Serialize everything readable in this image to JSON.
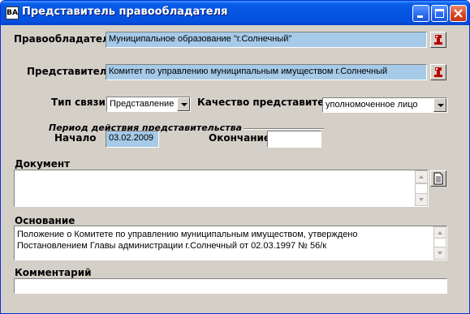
{
  "window": {
    "title": "Представитель правообладателя",
    "icon_text": "BA"
  },
  "form": {
    "owner": {
      "label": "Правообладатель",
      "value": "Муниципальное образование \"г.Солнечный\""
    },
    "rep": {
      "label": "Представитель",
      "value": "Комитет по управлению муниципальным имуществом г.Солнечный"
    },
    "link_type": {
      "label": "Тип связи",
      "value": "Представление"
    },
    "rep_quality": {
      "label": "Качество представителя",
      "value": "уполномоченное лицо"
    },
    "period": {
      "title": "Период действия представительства",
      "start_label": "Начало",
      "start_value": "03.02.2009",
      "end_label": "Окончание",
      "end_value": ""
    },
    "document": {
      "label": "Документ",
      "value": ""
    },
    "basis": {
      "label": "Основание",
      "value": "Положение о Комитете по управлению муниципальным имуществом, утверждено Постановлением Главы администрации г.Солнечный от 02.03.1997 № 56/к"
    },
    "comment": {
      "label": "Комментарий",
      "value": ""
    }
  },
  "colors": {
    "highlight_field": "#a6cae8",
    "titlebar": "#0553e1",
    "window_bg": "#d4d0c8"
  },
  "icons": [
    "app-icon",
    "minimize-icon",
    "maximize-icon",
    "close-icon",
    "lookup-icon",
    "document-icon"
  ]
}
